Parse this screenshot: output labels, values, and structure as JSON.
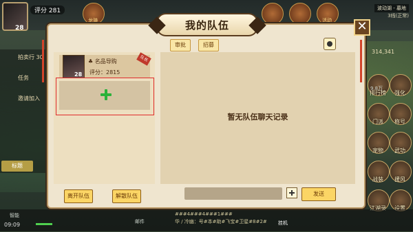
{
  "hud": {
    "player_level": "28",
    "power": "评分 281",
    "map_name": "波动湖 - 墓地",
    "map_sub": "3线(正常)",
    "coords": "314,341",
    "auction": "拍卖行 30",
    "task": "任务",
    "invite": "邀请加入",
    "left_tab": "标题",
    "clock": "09:09",
    "skill_label": "智能",
    "top_label_1": "龙骑",
    "top_label_2": "活动",
    "value_label": "9.8万",
    "bottom_chat_1": "###4###4###1###",
    "bottom_chat_2": "华 / 冷幽：号#本#助#飞宝#卫星#8#2#",
    "chat_tab": "邮件",
    "auto_btn": "挂机"
  },
  "right_menu": [
    {
      "label": "排行榜",
      "icon": "ranking-icon"
    },
    {
      "label": "强化",
      "icon": "forge-icon"
    },
    {
      "label": "门派",
      "icon": "sect-icon"
    },
    {
      "label": "称号",
      "icon": "title-icon"
    },
    {
      "label": "宠物",
      "icon": "pet-icon"
    },
    {
      "label": "武功",
      "icon": "martial-icon"
    },
    {
      "label": "战装",
      "icon": "gear-icon"
    },
    {
      "label": "援风",
      "icon": "wind-icon"
    },
    {
      "label": "江湖录",
      "icon": "book-icon"
    },
    {
      "label": "设置",
      "icon": "settings-icon"
    }
  ],
  "dialog": {
    "title": "我的队伍",
    "tab_review": "审批",
    "tab_recruit": "招募",
    "leader_tag": "队长",
    "member": {
      "name": "名品导购",
      "level": "28",
      "score": "评分：2815"
    },
    "empty_chat": "暂无队伍聊天记录",
    "leave_btn": "离开队伍",
    "disband_btn": "解散队伍",
    "send_btn": "发送"
  },
  "colors": {
    "highlight": "#e02a2a",
    "plus": "#2bb23a",
    "button": "#fbd565"
  }
}
